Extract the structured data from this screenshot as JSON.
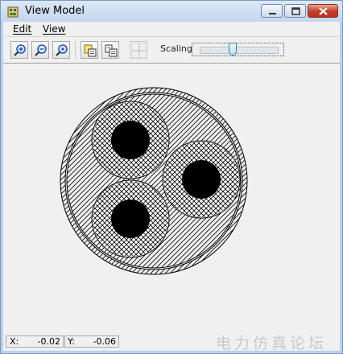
{
  "window": {
    "title": "View Model",
    "controls": {
      "minimize": "minimize",
      "maximize": "maximize",
      "close": "close"
    }
  },
  "menu": {
    "items": [
      {
        "label": "Edit"
      },
      {
        "label": "View"
      }
    ]
  },
  "toolbar": {
    "buttons": [
      {
        "icon": "zoom-in-icon"
      },
      {
        "icon": "zoom-out-icon"
      },
      {
        "icon": "zoom-fit-icon"
      },
      {
        "icon": "copy-bitmap-icon"
      },
      {
        "icon": "copy-text-icon"
      },
      {
        "icon": "grid-icon"
      }
    ],
    "scaling_label": "Scaling:",
    "scaling_level": 0.42
  },
  "model": {
    "description": "three-conductor cable cross section",
    "conductor_count": 3
  },
  "status": {
    "x_label": "X:",
    "x_value": "-0.02",
    "y_label": "Y:",
    "y_value": "-0.06"
  },
  "watermark": "电力仿真论坛",
  "colors": {
    "title_bar": "#c3d6ee",
    "close_button": "#c4422c",
    "conductor": "#000000",
    "background": "#f0f0f0"
  }
}
